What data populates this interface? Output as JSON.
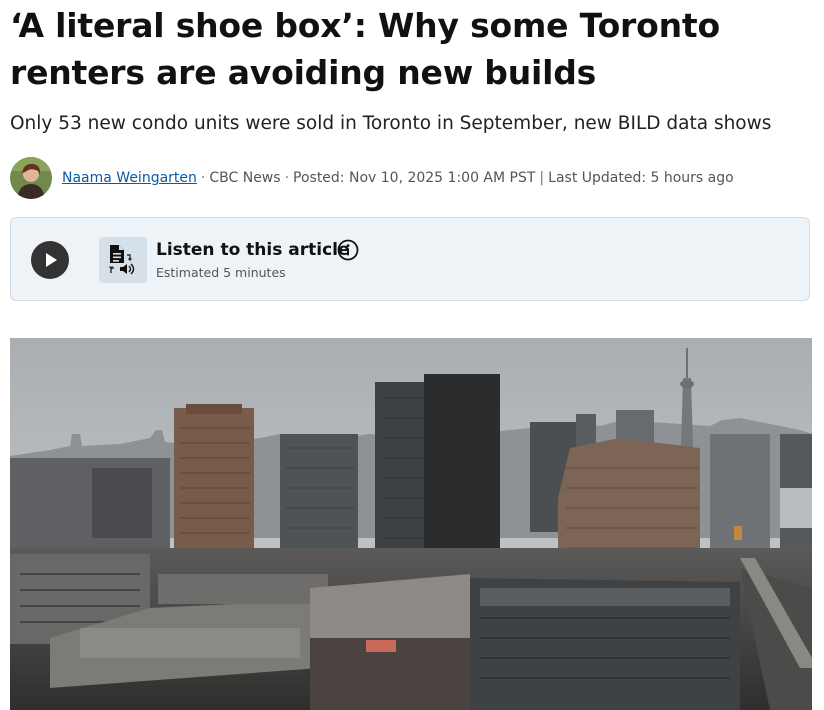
{
  "article": {
    "headline": "‘A literal shoe box’: Why some Toronto renters are avoiding new builds",
    "subheadline": "Only 53 new condo units were sold in Toronto in September, new BILD data shows"
  },
  "byline": {
    "author": "Naama Weingarten",
    "separator1": "·",
    "outlet": "CBC News",
    "separator2": "·",
    "posted": "Posted: Nov 10, 2025 1:00 AM PST",
    "separator3": "|",
    "updated": "Last Updated: 5 hours ago"
  },
  "audio_player": {
    "title": "Listen to this article",
    "estimate": "Estimated 5 minutes",
    "play_icon": "play-icon",
    "doc_icon": "text-to-speech-icon",
    "info_icon": "info-icon"
  },
  "colors": {
    "author_link": "#0b5aa7",
    "player_bg": "#eef3f7",
    "play_button": "#333333"
  }
}
